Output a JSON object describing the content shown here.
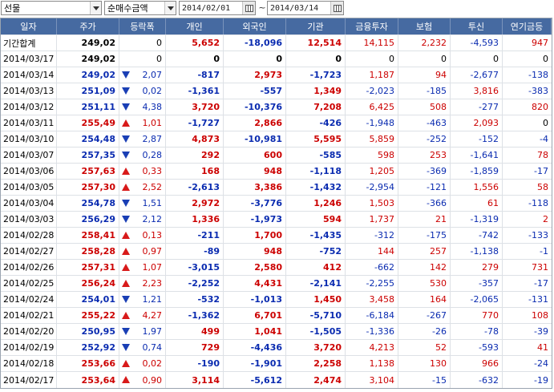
{
  "toolbar": {
    "market": "선물",
    "metric": "순매수금액",
    "from_date": "2014/02/01",
    "tilde": "~",
    "to_date": "2014/03/14"
  },
  "columns": [
    "일자",
    "주가",
    "등락폭",
    "개인",
    "외국인",
    "기관",
    "금융투자",
    "보험",
    "투신",
    "연기금등"
  ],
  "summary_rows": [
    {
      "date": "기간합계",
      "price": "249,02",
      "change": "0",
      "indiv": "5,652",
      "foreign": "-18,096",
      "inst": "12,514",
      "fininv": "14,115",
      "insur": "2,232",
      "trust": "-4,593",
      "pension": "947"
    },
    {
      "date": "2014/03/17",
      "price": "249,02",
      "change": "0",
      "indiv": "0",
      "foreign": "0",
      "inst": "0",
      "fininv": "0",
      "insur": "0",
      "trust": "0",
      "pension": "0"
    }
  ],
  "rows": [
    {
      "date": "2014/03/14",
      "price": "249,02",
      "dir": "down",
      "change": "2,07",
      "indiv": "-817",
      "foreign": "2,973",
      "inst": "-1,723",
      "fininv": "1,187",
      "insur": "94",
      "trust": "-2,677",
      "pension": "-138"
    },
    {
      "date": "2014/03/13",
      "price": "251,09",
      "dir": "down",
      "change": "0,02",
      "indiv": "-1,361",
      "foreign": "-557",
      "inst": "1,349",
      "fininv": "-2,023",
      "insur": "-185",
      "trust": "3,816",
      "pension": "-383"
    },
    {
      "date": "2014/03/12",
      "price": "251,11",
      "dir": "down",
      "change": "4,38",
      "indiv": "3,720",
      "foreign": "-10,376",
      "inst": "7,208",
      "fininv": "6,425",
      "insur": "508",
      "trust": "-277",
      "pension": "820"
    },
    {
      "date": "2014/03/11",
      "price": "255,49",
      "dir": "up",
      "change": "1,01",
      "indiv": "-1,727",
      "foreign": "2,866",
      "inst": "-426",
      "fininv": "-1,948",
      "insur": "-463",
      "trust": "2,093",
      "pension": "0"
    },
    {
      "date": "2014/03/10",
      "price": "254,48",
      "dir": "down",
      "change": "2,87",
      "indiv": "4,873",
      "foreign": "-10,981",
      "inst": "5,595",
      "fininv": "5,859",
      "insur": "-252",
      "trust": "-152",
      "pension": "-4"
    },
    {
      "date": "2014/03/07",
      "price": "257,35",
      "dir": "down",
      "change": "0,28",
      "indiv": "292",
      "foreign": "600",
      "inst": "-585",
      "fininv": "598",
      "insur": "253",
      "trust": "-1,641",
      "pension": "78"
    },
    {
      "date": "2014/03/06",
      "price": "257,63",
      "dir": "up",
      "change": "0,33",
      "indiv": "168",
      "foreign": "948",
      "inst": "-1,118",
      "fininv": "1,205",
      "insur": "-369",
      "trust": "-1,859",
      "pension": "-17"
    },
    {
      "date": "2014/03/05",
      "price": "257,30",
      "dir": "up",
      "change": "2,52",
      "indiv": "-2,613",
      "foreign": "3,386",
      "inst": "-1,432",
      "fininv": "-2,954",
      "insur": "-121",
      "trust": "1,556",
      "pension": "58"
    },
    {
      "date": "2014/03/04",
      "price": "254,78",
      "dir": "down",
      "change": "1,51",
      "indiv": "2,972",
      "foreign": "-3,776",
      "inst": "1,246",
      "fininv": "1,503",
      "insur": "-366",
      "trust": "61",
      "pension": "-118"
    },
    {
      "date": "2014/03/03",
      "price": "256,29",
      "dir": "down",
      "change": "2,12",
      "indiv": "1,336",
      "foreign": "-1,973",
      "inst": "594",
      "fininv": "1,737",
      "insur": "21",
      "trust": "-1,319",
      "pension": "2"
    },
    {
      "date": "2014/02/28",
      "price": "258,41",
      "dir": "up",
      "change": "0,13",
      "indiv": "-211",
      "foreign": "1,700",
      "inst": "-1,435",
      "fininv": "-312",
      "insur": "-175",
      "trust": "-742",
      "pension": "-133"
    },
    {
      "date": "2014/02/27",
      "price": "258,28",
      "dir": "up",
      "change": "0,97",
      "indiv": "-89",
      "foreign": "948",
      "inst": "-752",
      "fininv": "144",
      "insur": "257",
      "trust": "-1,138",
      "pension": "-1"
    },
    {
      "date": "2014/02/26",
      "price": "257,31",
      "dir": "up",
      "change": "1,07",
      "indiv": "-3,015",
      "foreign": "2,580",
      "inst": "412",
      "fininv": "-662",
      "insur": "142",
      "trust": "279",
      "pension": "731"
    },
    {
      "date": "2014/02/25",
      "price": "256,24",
      "dir": "up",
      "change": "2,23",
      "indiv": "-2,252",
      "foreign": "4,431",
      "inst": "-2,141",
      "fininv": "-2,255",
      "insur": "530",
      "trust": "-357",
      "pension": "-17"
    },
    {
      "date": "2014/02/24",
      "price": "254,01",
      "dir": "down",
      "change": "1,21",
      "indiv": "-532",
      "foreign": "-1,013",
      "inst": "1,450",
      "fininv": "3,458",
      "insur": "164",
      "trust": "-2,065",
      "pension": "-131"
    },
    {
      "date": "2014/02/21",
      "price": "255,22",
      "dir": "up",
      "change": "4,27",
      "indiv": "-1,362",
      "foreign": "6,701",
      "inst": "-5,710",
      "fininv": "-6,184",
      "insur": "-267",
      "trust": "770",
      "pension": "108"
    },
    {
      "date": "2014/02/20",
      "price": "250,95",
      "dir": "down",
      "change": "1,97",
      "indiv": "499",
      "foreign": "1,041",
      "inst": "-1,505",
      "fininv": "-1,336",
      "insur": "-26",
      "trust": "-78",
      "pension": "-39"
    },
    {
      "date": "2014/02/19",
      "price": "252,92",
      "dir": "down",
      "change": "0,74",
      "indiv": "729",
      "foreign": "-4,436",
      "inst": "3,720",
      "fininv": "4,213",
      "insur": "52",
      "trust": "-593",
      "pension": "41"
    },
    {
      "date": "2014/02/18",
      "price": "253,66",
      "dir": "up",
      "change": "0,02",
      "indiv": "-190",
      "foreign": "-1,901",
      "inst": "2,258",
      "fininv": "1,138",
      "insur": "130",
      "trust": "966",
      "pension": "-24"
    },
    {
      "date": "2014/02/17",
      "price": "253,64",
      "dir": "up",
      "change": "0,90",
      "indiv": "3,114",
      "foreign": "-5,612",
      "inst": "2,474",
      "fininv": "3,104",
      "insur": "-15",
      "trust": "-632",
      "pension": "-19"
    }
  ],
  "colors": {
    "header_bg": "#466aa1",
    "up_red": "#cc0000",
    "down_blue": "#0a2bb0",
    "up_arrow": "#d81a1a",
    "down_arrow": "#1a3fb5"
  }
}
